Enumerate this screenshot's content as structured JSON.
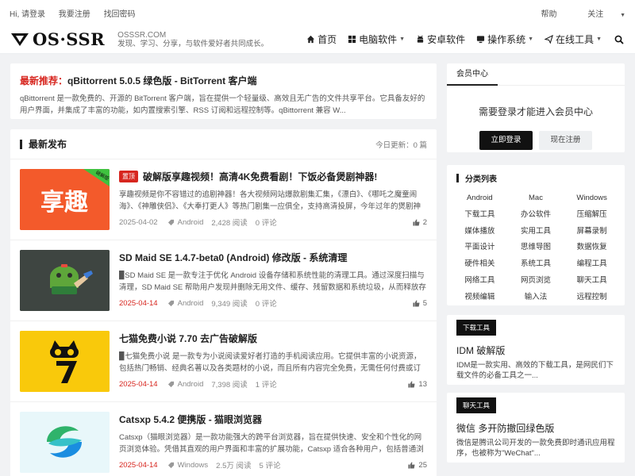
{
  "topbar": {
    "greeting": "Hi, 请登录",
    "register": "我要注册",
    "forgot": "找回密码",
    "help": "帮助",
    "follow": "关注"
  },
  "header": {
    "logo": "OS·SSR",
    "site": "OSSSR.COM",
    "slogan": "发现、学习、分享，与软件爱好者共同成长。",
    "nav": [
      {
        "label": "首页",
        "icon": "home-icon",
        "caret": false
      },
      {
        "label": "电脑软件",
        "icon": "windows-icon",
        "caret": true
      },
      {
        "label": "安卓软件",
        "icon": "android-icon",
        "caret": false
      },
      {
        "label": "操作系统",
        "icon": "monitor-icon",
        "caret": true
      },
      {
        "label": "在线工具",
        "icon": "send-icon",
        "caret": true
      }
    ]
  },
  "recommend": {
    "tag": "最新推荐：",
    "title": "qBittorrent 5.0.5 绿色版 - BitTorrent 客户端",
    "desc": "qBittorrent 是一款免费的、开源的 BitTorrent 客户端，旨在提供一个轻量级、高效且无广告的文件共享平台。它具备友好的用户界面，并集成了丰富的功能，如内置搜索引擎、RSS 订阅和远程控制等。qBittorrent 兼容 W..."
  },
  "latest": {
    "title": "最新发布",
    "updated": "今日更新：0 篇",
    "posts": [
      {
        "badge": "置顶",
        "title": "破解版享趣视频！高清4K免费看剧！下饭必备煲剧神器!",
        "excerpt": "享趣视频是你不容错过的追剧神器！各大视频网站爆款剧集汇集，《漂白》、《哪吒之魔童闹海》、《神雕侠侣》、《大奉打更人》等热门剧集一应俱全，支持高清投屏，今年过年的煲剧神器！",
        "date": "2025-04-02",
        "category": "Android",
        "views": "2,428 阅读",
        "comments": "0 评论",
        "likes": "2",
        "thumb_text": "享趣",
        "thumb_ribbon": "破解版"
      },
      {
        "badge": "",
        "title": "SD Maid SE 1.4.7-beta0 (Android) 修改版 - 系统清理",
        "excerpt": "▉SD Maid SE 是一款专注于优化 Android 设备存储和系统性能的清理工具。通过深度扫描与清理，SD Maid SE 帮助用户发现并删除无用文件、缓存、残留数据和系统垃圾，从而释放存储空间，提...",
        "date": "2025-04-14",
        "category": "Android",
        "views": "9,349 阅读",
        "comments": "0 评论",
        "likes": "5"
      },
      {
        "badge": "",
        "title": "七猫免费小说 7.70 去广告破解版",
        "excerpt": "▉七猫免费小说 是一款专为小说阅读爱好者打造的手机阅读应用。它提供丰富的小说资源，包括热门畅销、经典名著以及各类题材的小说，而且所有内容完全免费，无需任何付费或订阅。其用户友...",
        "date": "2025-04-14",
        "category": "Android",
        "views": "7,398 阅读",
        "comments": "1 评论",
        "likes": "13"
      },
      {
        "badge": "",
        "title": "Catsxp 5.4.2 便携版 - 猫眼浏览器",
        "excerpt": "Catsxp（猫眼浏览器）是一款功能强大的跨平台浏览器，旨在提供快速、安全和个性化的网页浏览体验。凭借其直观的用户界面和丰富的扩展功能，Catsxp 适合各种用户，包括普通浏览者和专业开...",
        "date": "2025-04-14",
        "category": "Windows",
        "views": "2.5万 阅读",
        "comments": "5 评论",
        "likes": "25"
      }
    ]
  },
  "sidebar": {
    "member_tab": "会员中心",
    "member_msg": "需要登录才能进入会员中心",
    "login": "立即登录",
    "register": "现在注册",
    "cats_title": "分类列表",
    "categories": [
      "Android",
      "Mac",
      "Windows",
      "下载工具",
      "办公软件",
      "压缩解压",
      "媒体播放",
      "实用工具",
      "屏幕录制",
      "平面设计",
      "思维导图",
      "数据恢复",
      "硬件相关",
      "系统工具",
      "编程工具",
      "网络工具",
      "网页浏览",
      "聊天工具",
      "视频编辑",
      "输入法",
      "远程控制"
    ],
    "featured": [
      {
        "label": "下载工具",
        "title": "IDM 破解版",
        "desc": "IDM是一款实用、高效的下载工具，是网民们下载文件的必备工具之一..."
      },
      {
        "label": "聊天工具",
        "title": "微信 多开防撤回绿色版",
        "desc": "微信是腾讯公司开发的一款免费即时通讯应用程序，也被称为\"WeChat\"..."
      }
    ]
  },
  "colors": {
    "accent_red": "#d7261f",
    "dark": "#111111",
    "page_bg": "#f1f2f4"
  }
}
